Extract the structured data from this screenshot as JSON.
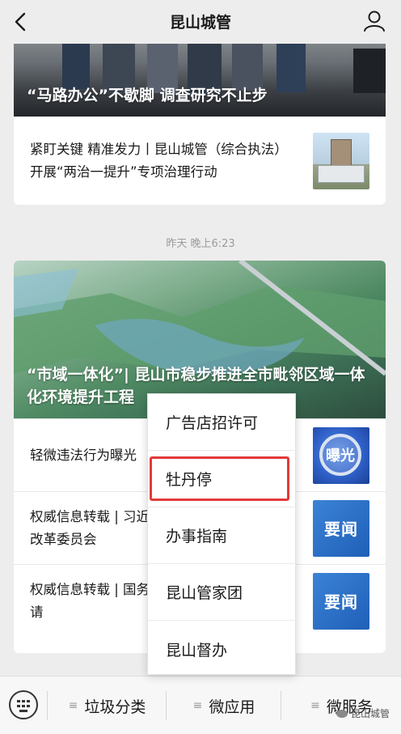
{
  "header": {
    "title": "昆山城管"
  },
  "feed": {
    "article1": {
      "cover_title": "“马路办公”不歇脚 调查研究不止步",
      "sub_title": "紧盯关键 精准发力丨昆山城管（综合执法）开展“两治一提升”专项治理行动"
    },
    "timestamp": "昨天 晚上6:23",
    "article2": {
      "cover_title": "“市域一体化”| 昆山市稳步推进全市毗邻区域一体化环境提升工程",
      "items": [
        {
          "title": "轻微违法行为曝光",
          "thumb_text": "曝光"
        },
        {
          "title": "权威信息转载 | 习近平主持召开中央全面深化改革委员会",
          "thumb_text": "要闻"
        },
        {
          "title": "权威信息转载 | 国务院：企业延期偿还需要申请",
          "thumb_text": "要闻"
        }
      ]
    }
  },
  "popup_menu": {
    "items": [
      "广告店招许可",
      "牡丹停",
      "办事指南",
      "昆山管家团",
      "昆山督办"
    ],
    "highlighted_index": 1,
    "highlight_color": "#e33a3a"
  },
  "bottom_menu": {
    "tabs": [
      "垃圾分类",
      "微应用",
      "微服务"
    ]
  },
  "watermark": {
    "text": "昆山城管"
  }
}
